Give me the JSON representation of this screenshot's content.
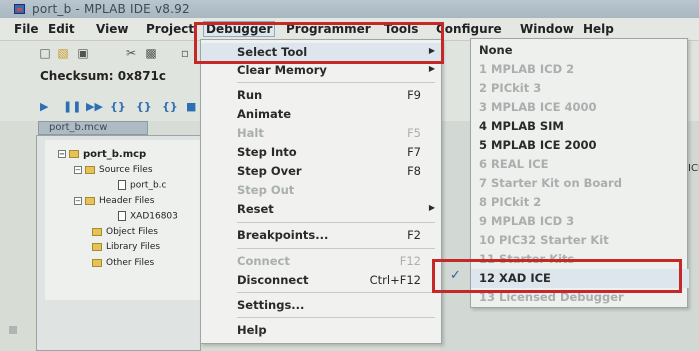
{
  "window": {
    "title": "port_b - MPLAB IDE v8.92"
  },
  "menubar": {
    "items": [
      "File",
      "Edit",
      "View",
      "Project",
      "Debugger",
      "Programmer",
      "Tools",
      "Configure",
      "Window",
      "Help"
    ]
  },
  "toolbar": {
    "checksum_label": "Checksum:",
    "checksum_value": "0x871c"
  },
  "project": {
    "tab_label": "port_b.mcw",
    "root": "port_b.mcp",
    "source_files": "Source Files",
    "source_file": "port_b.c",
    "header_files": "Header Files",
    "header_file": "XAD16803",
    "object_files": "Object Files",
    "library_files": "Library Files",
    "other_files": "Other Files"
  },
  "side_text": "ICI",
  "debugger_menu": {
    "items": [
      {
        "label": "Select Tool",
        "shortcut": "",
        "submenu": true,
        "disabled": false
      },
      {
        "label": "Clear Memory",
        "shortcut": "",
        "submenu": true,
        "disabled": false
      },
      {
        "label": "Run",
        "shortcut": "F9",
        "submenu": false,
        "disabled": false
      },
      {
        "label": "Animate",
        "shortcut": "",
        "submenu": false,
        "disabled": false
      },
      {
        "label": "Halt",
        "shortcut": "F5",
        "submenu": false,
        "disabled": true
      },
      {
        "label": "Step Into",
        "shortcut": "F7",
        "submenu": false,
        "disabled": false
      },
      {
        "label": "Step Over",
        "shortcut": "F8",
        "submenu": false,
        "disabled": false
      },
      {
        "label": "Step Out",
        "shortcut": "",
        "submenu": false,
        "disabled": true
      },
      {
        "label": "Reset",
        "shortcut": "",
        "submenu": true,
        "disabled": false
      },
      {
        "label": "Breakpoints...",
        "shortcut": "F2",
        "submenu": false,
        "disabled": false
      },
      {
        "label": "Connect",
        "shortcut": "F12",
        "submenu": false,
        "disabled": true
      },
      {
        "label": "Disconnect",
        "shortcut": "Ctrl+F12",
        "submenu": false,
        "disabled": false
      },
      {
        "label": "Settings...",
        "shortcut": "",
        "submenu": false,
        "disabled": false
      },
      {
        "label": "Help",
        "shortcut": "",
        "submenu": false,
        "disabled": false
      }
    ]
  },
  "select_tool_submenu": {
    "items": [
      {
        "label": "None",
        "disabled": false
      },
      {
        "label": "1 MPLAB ICD 2",
        "disabled": true
      },
      {
        "label": "2 PICkit 3",
        "disabled": true
      },
      {
        "label": "3 MPLAB ICE 4000",
        "disabled": true
      },
      {
        "label": "4 MPLAB SIM",
        "disabled": false
      },
      {
        "label": "5 MPLAB ICE 2000",
        "disabled": false
      },
      {
        "label": "6 REAL ICE",
        "disabled": true
      },
      {
        "label": "7 Starter Kit on Board",
        "disabled": true
      },
      {
        "label": "8 PICkit 2",
        "disabled": true
      },
      {
        "label": "9 MPLAB ICD 3",
        "disabled": true
      },
      {
        "label": "10 PIC32 Starter Kit",
        "disabled": true
      },
      {
        "label": "11 Starter Kits",
        "disabled": true
      },
      {
        "label": "12 XAD ICE",
        "disabled": false,
        "checked": true
      },
      {
        "label": "13 Licensed Debugger",
        "disabled": true
      }
    ]
  },
  "colors": {
    "highlight_box": "#c62828",
    "check": "#2d5fa7"
  }
}
